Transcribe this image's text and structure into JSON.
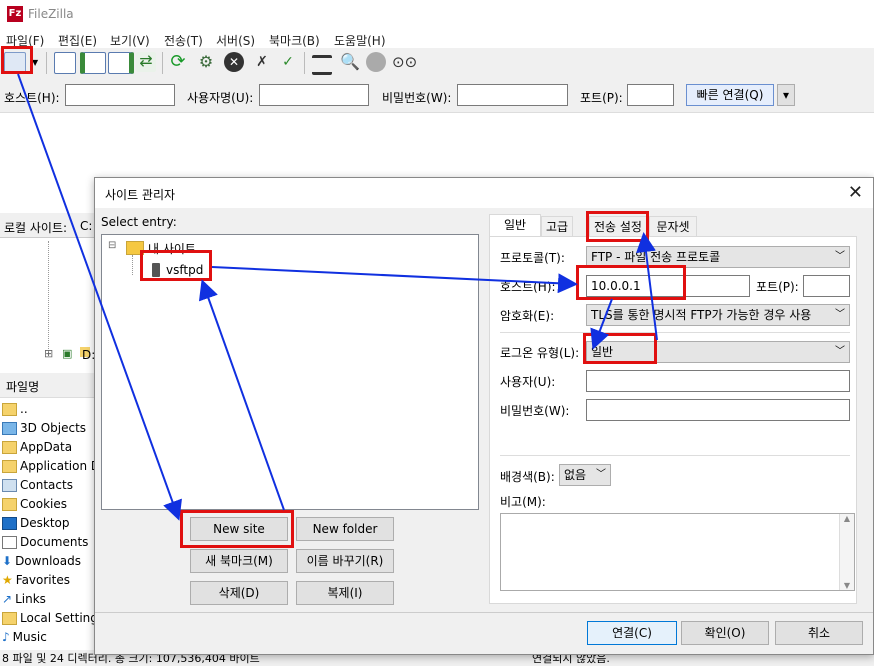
{
  "app": {
    "title": "FileZilla",
    "icon_text": "Fz"
  },
  "menu": [
    "파일(F)",
    "편집(E)",
    "보기(V)",
    "전송(T)",
    "서버(S)",
    "북마크(B)",
    "도움말(H)"
  ],
  "quickconnect": {
    "host_label": "호스트(H):",
    "user_label": "사용자명(U):",
    "pass_label": "비밀번호(W):",
    "port_label": "포트(P):",
    "button": "빠른 연결(Q)"
  },
  "local_site_label": "로컬 사이트:",
  "local_site_drive": "C:",
  "file_header": "파일명",
  "left_items": [
    "..",
    "3D Objects",
    "AppData",
    "Application D",
    "Contacts",
    "Cookies",
    "Desktop",
    "Documents",
    "Downloads",
    "Favorites",
    "Links",
    "Local Setting",
    "Music"
  ],
  "status_left": "8 파일 및 24 디렉터리. 총 크기: 107,536,404 바이트",
  "status_right": "연결되지 않았음.",
  "dialog": {
    "title": "사이트 관리자",
    "select_entry": "Select entry:",
    "tree_root": "내 사이트",
    "tree_child": "vsftpd",
    "buttons": {
      "new_site": "New site",
      "new_folder": "New folder",
      "new_bookmark": "새 북마크(M)",
      "rename": "이름 바꾸기(R)",
      "delete": "삭제(D)",
      "duplicate": "복제(I)",
      "connect": "연결(C)",
      "ok": "확인(O)",
      "cancel": "취소"
    },
    "tabs": [
      "일반",
      "고급",
      "전송 설정",
      "문자셋"
    ],
    "fields": {
      "protocol_label": "프로토콜(T):",
      "protocol_value": "FTP - 파일 전송 프로토콜",
      "host_label": "호스트(H):",
      "host_value": "10.0.0.1",
      "port_label": "포트(P):",
      "encryption_label": "암호화(E):",
      "encryption_value": "TLS를 통한 명시적 FTP가 가능한 경우 사용",
      "logon_label": "로그온 유형(L):",
      "logon_value": "일반",
      "user_label": "사용자(U):",
      "password_label": "비밀번호(W):",
      "bgcolor_label": "배경색(B):",
      "bgcolor_value": "없음",
      "comment_label": "비고(M):"
    }
  },
  "colors": {
    "annotation_red": "#e01010",
    "annotation_blue": "#1030e0"
  }
}
